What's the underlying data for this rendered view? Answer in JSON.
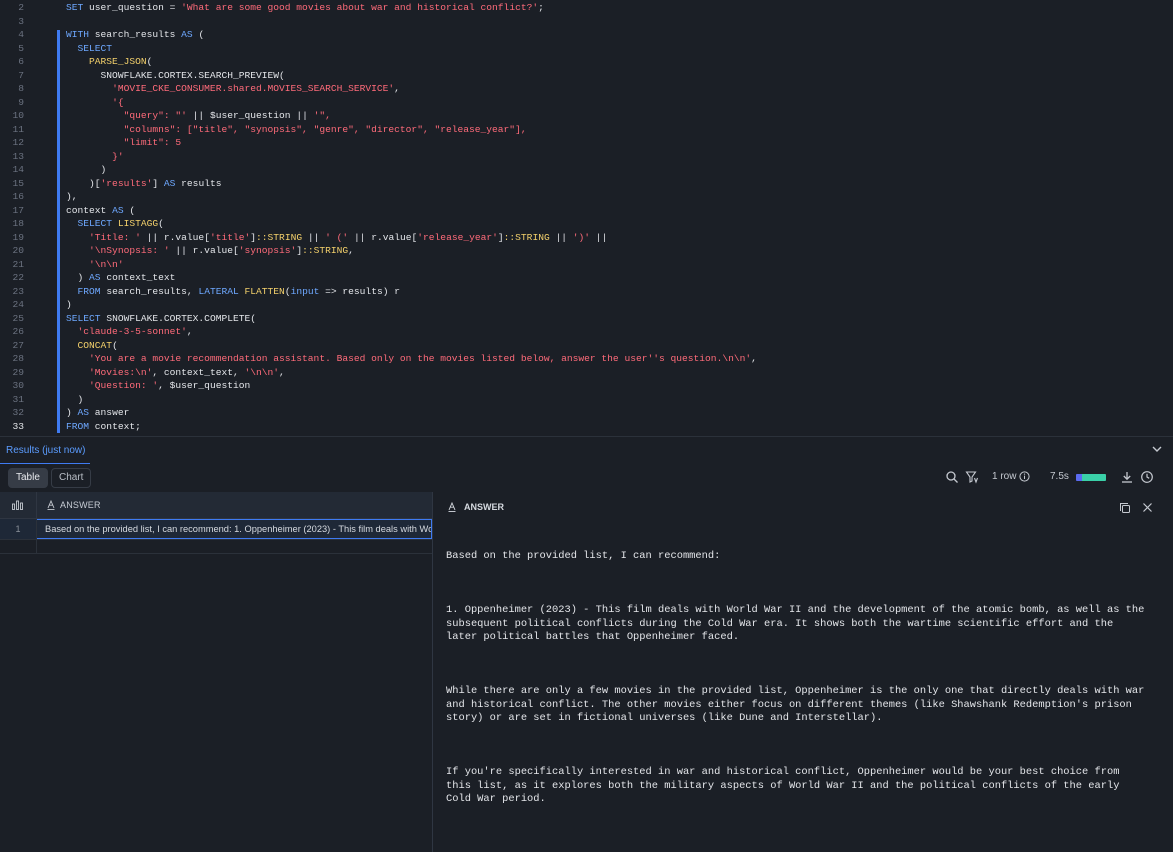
{
  "editor": {
    "active_line": 33,
    "lines": [
      {
        "n": 2,
        "tokens": [
          [
            "kw",
            "SET "
          ],
          [
            "id",
            "user_question = "
          ],
          [
            "str",
            "'What are some good movies about war and historical conflict?'"
          ],
          [
            "op",
            ";"
          ]
        ]
      },
      {
        "n": 3,
        "tokens": []
      },
      {
        "n": 4,
        "tokens": [
          [
            "kw",
            "WITH "
          ],
          [
            "id",
            "search_results "
          ],
          [
            "kw",
            "AS "
          ],
          [
            "op",
            "("
          ]
        ]
      },
      {
        "n": 5,
        "tokens": [
          [
            "op",
            "  "
          ],
          [
            "kw",
            "SELECT"
          ]
        ]
      },
      {
        "n": 6,
        "tokens": [
          [
            "op",
            "    "
          ],
          [
            "fn",
            "PARSE_JSON"
          ],
          [
            "op",
            "("
          ]
        ]
      },
      {
        "n": 7,
        "tokens": [
          [
            "op",
            "      "
          ],
          [
            "id",
            "SNOWFLAKE.CORTEX.SEARCH_PREVIEW"
          ],
          [
            "op",
            "("
          ]
        ]
      },
      {
        "n": 8,
        "tokens": [
          [
            "op",
            "        "
          ],
          [
            "str",
            "'MOVIE_CKE_CONSUMER.shared.MOVIES_SEARCH_SERVICE'"
          ],
          [
            "op",
            ","
          ]
        ]
      },
      {
        "n": 9,
        "tokens": [
          [
            "op",
            "        "
          ],
          [
            "str",
            "'{"
          ]
        ]
      },
      {
        "n": 10,
        "tokens": [
          [
            "op",
            "          "
          ],
          [
            "str",
            "\"query\": \"' "
          ],
          [
            "op",
            "|| "
          ],
          [
            "id",
            "$user_question "
          ],
          [
            "op",
            "|| "
          ],
          [
            "str",
            "'\","
          ]
        ]
      },
      {
        "n": 11,
        "tokens": [
          [
            "op",
            "          "
          ],
          [
            "str",
            "\"columns\": [\"title\", \"synopsis\", \"genre\", \"director\", \"release_year\"],"
          ]
        ]
      },
      {
        "n": 12,
        "tokens": [
          [
            "op",
            "          "
          ],
          [
            "str",
            "\"limit\": 5"
          ]
        ]
      },
      {
        "n": 13,
        "tokens": [
          [
            "op",
            "        "
          ],
          [
            "str",
            "}'"
          ]
        ]
      },
      {
        "n": 14,
        "tokens": [
          [
            "op",
            "      )"
          ]
        ]
      },
      {
        "n": 15,
        "tokens": [
          [
            "op",
            "    )["
          ],
          [
            "str",
            "'results'"
          ],
          [
            "op",
            "] "
          ],
          [
            "kw",
            "AS "
          ],
          [
            "id",
            "results"
          ]
        ]
      },
      {
        "n": 16,
        "tokens": [
          [
            "op",
            "),"
          ]
        ]
      },
      {
        "n": 17,
        "tokens": [
          [
            "id",
            "context "
          ],
          [
            "kw",
            "AS "
          ],
          [
            "op",
            "("
          ]
        ]
      },
      {
        "n": 18,
        "tokens": [
          [
            "op",
            "  "
          ],
          [
            "kw",
            "SELECT "
          ],
          [
            "fn",
            "LISTAGG"
          ],
          [
            "op",
            "("
          ]
        ]
      },
      {
        "n": 19,
        "tokens": [
          [
            "op",
            "    "
          ],
          [
            "str",
            "'Title: ' "
          ],
          [
            "op",
            "|| "
          ],
          [
            "id",
            "r.value["
          ],
          [
            "str",
            "'title'"
          ],
          [
            "id",
            "]"
          ],
          [
            "fn",
            "::STRING "
          ],
          [
            "op",
            "|| "
          ],
          [
            "str",
            "' (' "
          ],
          [
            "op",
            "|| "
          ],
          [
            "id",
            "r.value["
          ],
          [
            "str",
            "'release_year'"
          ],
          [
            "id",
            "]"
          ],
          [
            "fn",
            "::STRING "
          ],
          [
            "op",
            "|| "
          ],
          [
            "str",
            "')' "
          ],
          [
            "op",
            "||"
          ]
        ]
      },
      {
        "n": 20,
        "tokens": [
          [
            "op",
            "    "
          ],
          [
            "str",
            "'\\nSynopsis: ' "
          ],
          [
            "op",
            "|| "
          ],
          [
            "id",
            "r.value["
          ],
          [
            "str",
            "'synopsis'"
          ],
          [
            "id",
            "]"
          ],
          [
            "fn",
            "::STRING"
          ],
          [
            "op",
            ","
          ]
        ]
      },
      {
        "n": 21,
        "tokens": [
          [
            "op",
            "    "
          ],
          [
            "str",
            "'\\n\\n'"
          ]
        ]
      },
      {
        "n": 22,
        "tokens": [
          [
            "op",
            "  ) "
          ],
          [
            "kw",
            "AS "
          ],
          [
            "id",
            "context_text"
          ]
        ]
      },
      {
        "n": 23,
        "tokens": [
          [
            "op",
            "  "
          ],
          [
            "kw",
            "FROM "
          ],
          [
            "id",
            "search_results, "
          ],
          [
            "kw",
            "LATERAL "
          ],
          [
            "fn",
            "FLATTEN"
          ],
          [
            "op",
            "("
          ],
          [
            "kw",
            "input "
          ],
          [
            "op",
            "=> "
          ],
          [
            "id",
            "results) r"
          ]
        ]
      },
      {
        "n": 24,
        "tokens": [
          [
            "op",
            ")"
          ]
        ]
      },
      {
        "n": 25,
        "tokens": [
          [
            "kw",
            "SELECT "
          ],
          [
            "id",
            "SNOWFLAKE.CORTEX.COMPLETE"
          ],
          [
            "op",
            "("
          ]
        ]
      },
      {
        "n": 26,
        "tokens": [
          [
            "op",
            "  "
          ],
          [
            "str",
            "'claude-3-5-sonnet'"
          ],
          [
            "op",
            ","
          ]
        ]
      },
      {
        "n": 27,
        "tokens": [
          [
            "op",
            "  "
          ],
          [
            "fn",
            "CONCAT"
          ],
          [
            "op",
            "("
          ]
        ]
      },
      {
        "n": 28,
        "tokens": [
          [
            "op",
            "    "
          ],
          [
            "str",
            "'You are a movie recommendation assistant. Based only on the movies listed below, answer the user''s question.\\n\\n'"
          ],
          [
            "op",
            ","
          ]
        ]
      },
      {
        "n": 29,
        "tokens": [
          [
            "op",
            "    "
          ],
          [
            "str",
            "'Movies:\\n'"
          ],
          [
            "op",
            ", "
          ],
          [
            "id",
            "context_text"
          ],
          [
            "op",
            ", "
          ],
          [
            "str",
            "'\\n\\n'"
          ],
          [
            "op",
            ","
          ]
        ]
      },
      {
        "n": 30,
        "tokens": [
          [
            "op",
            "    "
          ],
          [
            "str",
            "'Question: '"
          ],
          [
            "op",
            ", "
          ],
          [
            "id",
            "$user_question"
          ]
        ]
      },
      {
        "n": 31,
        "tokens": [
          [
            "op",
            "  )"
          ]
        ]
      },
      {
        "n": 32,
        "tokens": [
          [
            "op",
            ") "
          ],
          [
            "kw",
            "AS "
          ],
          [
            "id",
            "answer"
          ]
        ]
      },
      {
        "n": 33,
        "tokens": [
          [
            "kw",
            "FROM "
          ],
          [
            "id",
            "context;"
          ]
        ]
      }
    ]
  },
  "results": {
    "title": "Results (just now)",
    "tabs": [
      "Table",
      "Chart"
    ],
    "row_count": "1 row",
    "elapsed": "7.5s",
    "progress_split": [
      0.2,
      1.0
    ],
    "table": {
      "column": "ANSWER",
      "rows": [
        {
          "num": "1",
          "answer": "Based on the provided list, I can recommend: 1. Oppenheimer (2023) - This film deals with World War II and the development of the atomic bomb"
        }
      ]
    }
  },
  "detail": {
    "title": "ANSWER",
    "paragraphs": [
      "Based on the provided list, I can recommend:",
      "1. Oppenheimer (2023) - This film deals with World War II and the development of the atomic bomb, as well as the\nsubsequent political conflicts during the Cold War era. It shows both the wartime scientific effort and the\nlater political battles that Oppenheimer faced.",
      "While there are only a few movies in the provided list, Oppenheimer is the only one that directly deals with war\nand historical conflict. The other movies either focus on different themes (like Shawshank Redemption's prison\nstory) or are set in fictional universes (like Dune and Interstellar).",
      "If you're specifically interested in war and historical conflict, Oppenheimer would be your best choice from\nthis list, as it explores both the military aspects of World War II and the political conflicts of the early\nCold War period."
    ]
  },
  "colors": {
    "accent": "#3f7bf2",
    "keyword": "#6ea8ff",
    "function": "#f3d06b",
    "string": "#ff6b7a"
  }
}
